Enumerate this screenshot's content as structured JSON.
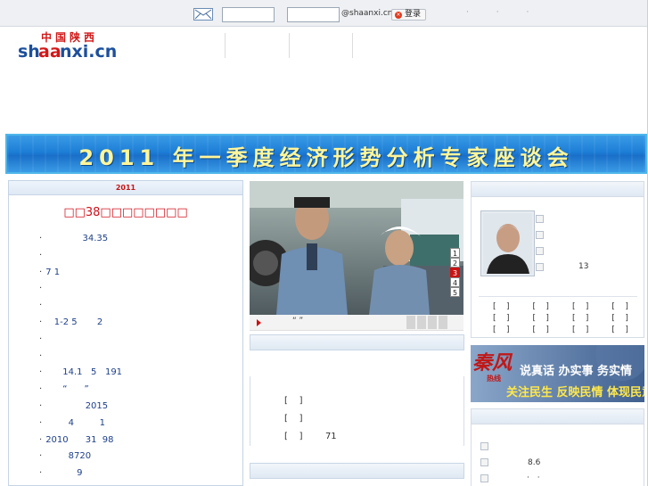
{
  "topbar": {
    "username_placeholder": "",
    "password_placeholder": "",
    "domain": "@shaanxi.cn",
    "login_label": "登录",
    "extra_dots": "· · ·"
  },
  "logo": {
    "chinese": "中国陕西",
    "latin": "shaanxi.cn"
  },
  "banner": {
    "title": "2011 年一季度经济形势分析专家座谈会"
  },
  "left": {
    "header": "2011",
    "headline": "□□38□□□□□□□□",
    "news": [
      {
        "bullet": "·",
        "text": "             34.35"
      },
      {
        "bullet": "·",
        "text": ""
      },
      {
        "bullet": "·",
        "text": "7 1"
      },
      {
        "bullet": "·",
        "text": ""
      },
      {
        "bullet": "·",
        "text": ""
      },
      {
        "bullet": "·",
        "text": "   1-2 5       2"
      },
      {
        "bullet": "·",
        "text": ""
      },
      {
        "bullet": "·",
        "text": ""
      },
      {
        "bullet": "·",
        "text": "      14.1   5   191"
      },
      {
        "bullet": "·",
        "text": "      “      ”"
      },
      {
        "bullet": "·",
        "text": "              2015"
      },
      {
        "bullet": "·",
        "text": "        4         1"
      },
      {
        "bullet": "·",
        "text": "2010      31  98"
      },
      {
        "bullet": "·",
        "text": "        8720"
      },
      {
        "bullet": "·",
        "text": "           9"
      }
    ]
  },
  "middle": {
    "caption": "“   ”",
    "pager": [
      "1",
      "2",
      "3",
      "4",
      "5"
    ],
    "active_page": "3",
    "list": [
      "[    ]",
      "[    ]",
      "[    ]        71"
    ]
  },
  "right": {
    "count": "13",
    "brackets": [
      [
        "[    ]",
        "[    ]",
        "[    ]",
        "[    ]"
      ],
      [
        "[    ]",
        "[    ]",
        "[    ]",
        "[    ]"
      ],
      [
        "[    ]",
        "[    ]",
        "[    ]",
        "[    ]"
      ]
    ],
    "ad": {
      "logo_big": "秦风",
      "logo_small": "热线",
      "line1": "说真话 办实事 务实情",
      "line2": "关注民生 反映民情 体现民意"
    },
    "num": "8.6",
    "dots": "· ·"
  },
  "colors": {
    "accent_red": "#c81414",
    "banner_blue": "#1d7ed6",
    "banner_text": "#fff59a"
  }
}
